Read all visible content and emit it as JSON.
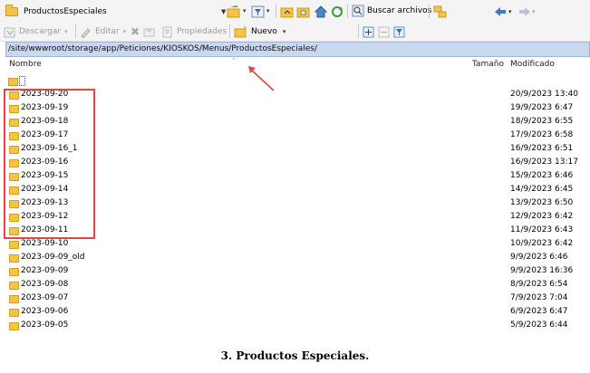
{
  "toolbar": {
    "current_folder": "ProductosEspeciales",
    "search_label": "Buscar archivos",
    "download_label": "Descargar",
    "edit_label": "Editar",
    "properties_label": "Propiedades",
    "new_label": "Nuevo"
  },
  "path": "/site/wwwroot/storage/app/Peticiones/KIOSKOS/Menus/ProductosEspeciales/",
  "columns": {
    "name": "Nombre",
    "size": "Tamaño",
    "modified": "Modificado"
  },
  "rows": [
    {
      "name": "2023-09-20",
      "modified": "20/9/2023 13:40"
    },
    {
      "name": "2023-09-19",
      "modified": "19/9/2023 6:47"
    },
    {
      "name": "2023-09-18",
      "modified": "18/9/2023 6:55"
    },
    {
      "name": "2023-09-17",
      "modified": "17/9/2023 6:58"
    },
    {
      "name": "2023-09-16_1",
      "modified": "16/9/2023 6:51"
    },
    {
      "name": "2023-09-16",
      "modified": "16/9/2023 13:17"
    },
    {
      "name": "2023-09-15",
      "modified": "15/9/2023 6:46"
    },
    {
      "name": "2023-09-14",
      "modified": "14/9/2023 6:45"
    },
    {
      "name": "2023-09-13",
      "modified": "13/9/2023 6:50"
    },
    {
      "name": "2023-09-12",
      "modified": "12/9/2023 6:42"
    },
    {
      "name": "2023-09-11",
      "modified": "11/9/2023 6:43"
    },
    {
      "name": "2023-09-10",
      "modified": "10/9/2023 6:42"
    },
    {
      "name": "2023-09-09_old",
      "modified": "9/9/2023 6:46"
    },
    {
      "name": "2023-09-09",
      "modified": "9/9/2023 16:36"
    },
    {
      "name": "2023-09-08",
      "modified": "8/9/2023 6:54"
    },
    {
      "name": "2023-09-07",
      "modified": "7/9/2023 7:04"
    },
    {
      "name": "2023-09-06",
      "modified": "6/9/2023 6:47"
    },
    {
      "name": "2023-09-05",
      "modified": "5/9/2023 6:44"
    }
  ],
  "caption": "3. Productos Especiales.",
  "colors": {
    "path_bar": "#c9d8ec",
    "folder": "#f3c34a",
    "annotation_red": "#e14545"
  }
}
